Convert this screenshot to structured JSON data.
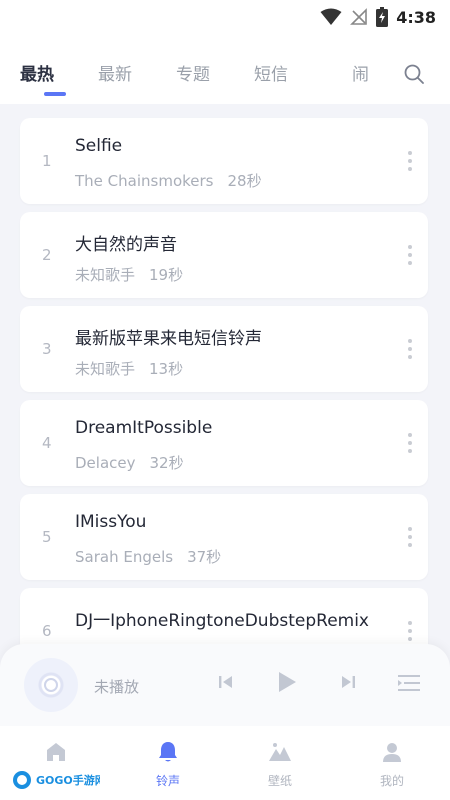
{
  "status_bar": {
    "time": "4:38",
    "icons": [
      "wifi-icon",
      "no-signal-icon",
      "battery-charging-icon"
    ]
  },
  "tabs": [
    {
      "label": "最热",
      "active": true
    },
    {
      "label": "最新",
      "active": false
    },
    {
      "label": "专题",
      "active": false
    },
    {
      "label": "短信",
      "active": false
    },
    {
      "label": "闹",
      "active": false
    }
  ],
  "songs": [
    {
      "rank": "1",
      "title": "Selfie",
      "artist": "The Chainsmokers",
      "duration": "28秒"
    },
    {
      "rank": "2",
      "title": "大自然的声音",
      "artist": "未知歌手",
      "duration": "19秒"
    },
    {
      "rank": "3",
      "title": "最新版苹果来电短信铃声",
      "artist": "未知歌手",
      "duration": "13秒"
    },
    {
      "rank": "4",
      "title": "DreamItPossible",
      "artist": "Delacey",
      "duration": "32秒"
    },
    {
      "rank": "5",
      "title": "IMissYou",
      "artist": "Sarah Engels",
      "duration": "37秒"
    },
    {
      "rank": "6",
      "title": "DJ一IphoneRingtoneDubstepRemix",
      "artist": "",
      "duration": ""
    }
  ],
  "player": {
    "status": "未播放"
  },
  "bottom_nav": [
    {
      "label": "",
      "icon": "home-icon",
      "active": false
    },
    {
      "label": "铃声",
      "icon": "bell-icon",
      "active": true
    },
    {
      "label": "壁纸",
      "icon": "wallpaper-icon",
      "active": false
    },
    {
      "label": "我的",
      "icon": "profile-icon",
      "active": false
    }
  ],
  "watermark": {
    "text": "GOGO手游网"
  },
  "colors": {
    "accent": "#5b76f5",
    "background": "#f3f4f9",
    "card": "#ffffff"
  }
}
